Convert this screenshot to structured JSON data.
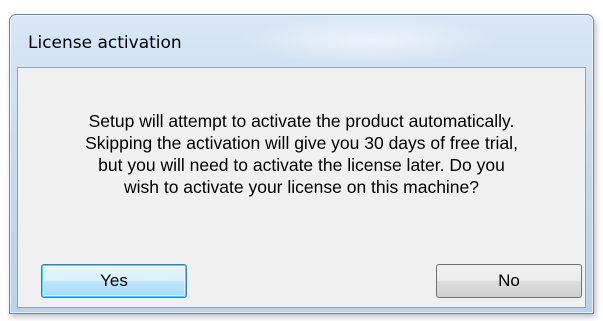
{
  "dialog": {
    "title": "License activation",
    "message_lines": [
      "Setup will attempt to activate the product automatically.",
      "Skipping the activation will give you 30 days of free trial,",
      "but you will need to activate the license later. Do you",
      "wish to activate your license on this machine?"
    ],
    "buttons": {
      "yes_label": "Yes",
      "no_label": "No"
    }
  },
  "colors": {
    "titlebar": "#c5d9ee",
    "client_background": "#f0f0f0",
    "default_button_accent": "#48d2f8"
  }
}
